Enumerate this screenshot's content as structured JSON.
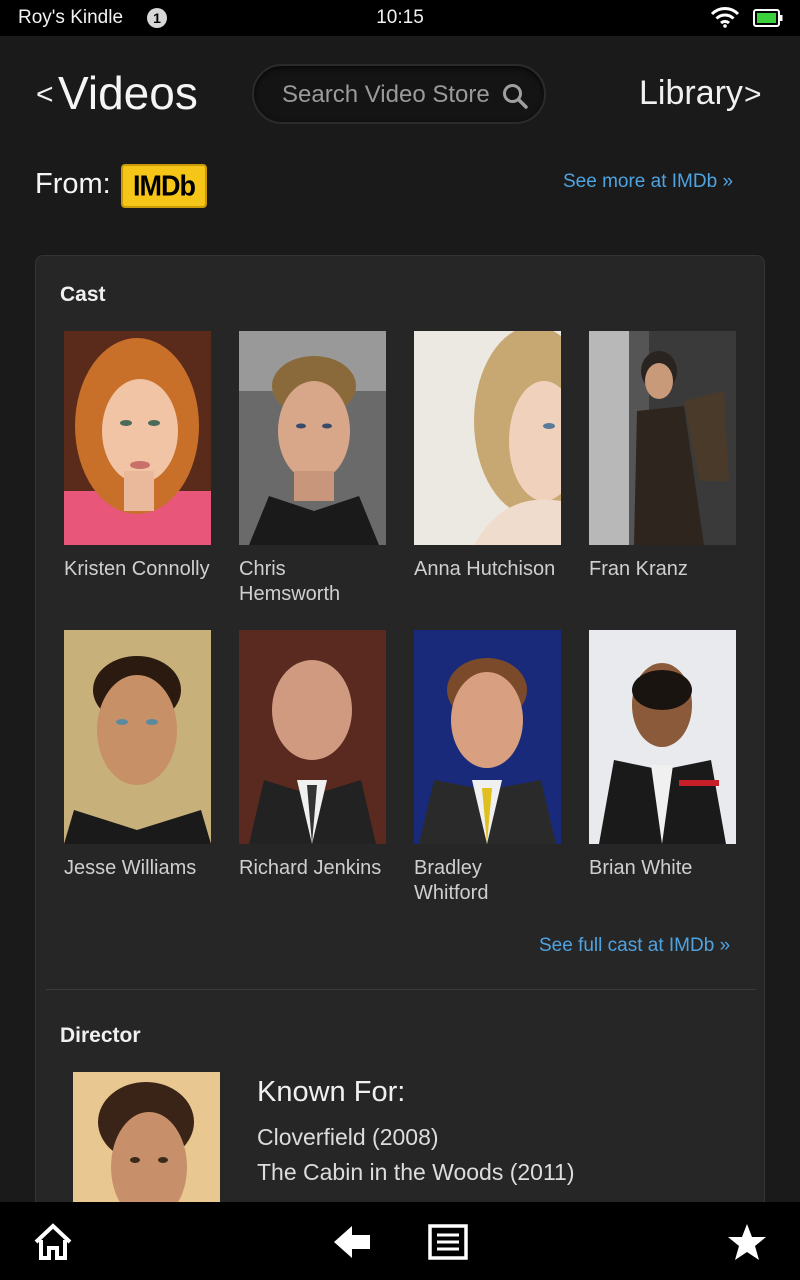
{
  "status_bar": {
    "device_name": "Roy's Kindle",
    "notification_count": "1",
    "time": "10:15"
  },
  "header": {
    "back_glyph": "<",
    "title": "Videos",
    "search_placeholder": "Search Video Store",
    "library_label": "Library",
    "library_glyph": ">"
  },
  "source": {
    "from_label": "From:",
    "logo_text": "IMDb",
    "see_more_label": "See more at IMDb »"
  },
  "cast": {
    "heading": "Cast",
    "members": [
      {
        "name": "Kristen Connolly"
      },
      {
        "name": "Chris Hemsworth"
      },
      {
        "name": "Anna Hutchison"
      },
      {
        "name": "Fran Kranz"
      },
      {
        "name": "Jesse Williams"
      },
      {
        "name": "Richard Jenkins"
      },
      {
        "name": "Bradley Whitford"
      },
      {
        "name": "Brian White"
      }
    ],
    "see_full_label": "See full cast at IMDb »"
  },
  "director": {
    "heading": "Director",
    "known_for_title": "Known For:",
    "known_for": [
      "Cloverfield (2008)",
      "The Cabin in the Woods (2011)"
    ]
  },
  "bottom_nav": {
    "icons": [
      "home-icon",
      "back-arrow-icon",
      "menu-icon",
      "favorites-star-icon"
    ]
  },
  "colors": {
    "link": "#4fa3e0",
    "imdb_yellow": "#f5c518",
    "background": "#1a1a1a",
    "panel": "#262626"
  }
}
